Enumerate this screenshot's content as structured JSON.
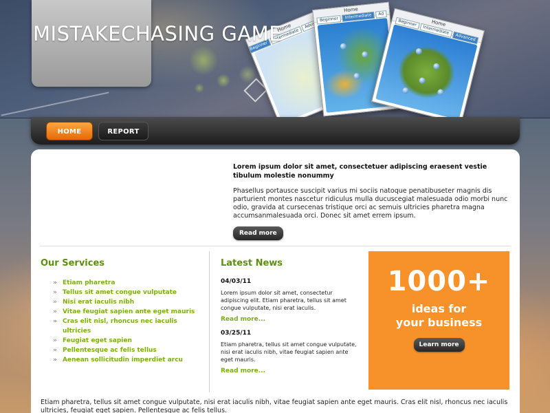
{
  "site": {
    "title": "MISTAKECHASING GAME"
  },
  "promo_cards": [
    {
      "chrome_title": "Home",
      "tabs": [
        "Beginner",
        "Intermediate",
        "Advanced"
      ],
      "active_tab": 0
    },
    {
      "chrome_title": "Home",
      "tabs": [
        "Beginner",
        "Intermediate",
        "Ad"
      ],
      "active_tab": 1
    },
    {
      "chrome_title": "Home",
      "tabs": [
        "Beginner",
        "Intermediate",
        "Advanced"
      ],
      "active_tab": 2
    }
  ],
  "nav": {
    "home": "HOME",
    "report": "REPORT"
  },
  "intro": {
    "heading": "Lorem ipsum dolor sit amet, consectetuer adipiscing eraesent vestie tibulum molestie nonummy",
    "body": "Phasellus portausce suscipit varius mi sociis natoque penatibuseter magnis dis parturient montes nascetur ridiculus mulla ducuscegiat malesuada odio morbi nunc odio, gravida at cursecenas tristique orci ac semuis ultricies pharetra magna accumsanmalesuada orci. Donec sit amet errem ipsum.",
    "button": "Read more"
  },
  "services": {
    "title": "Our Services",
    "items": [
      "Etiam pharetra",
      "Tellus sit amet congue vulputate",
      "Nisi erat iaculis nibh",
      "Vitae feugiat sapien ante eget mauris",
      "Cras elit nisl, rhoncus nec iaculis ultricies",
      "Feugiat eget sapien",
      "Pellentesque ac felis tellus",
      "Aenean sollicitudin imperdiet arcu"
    ]
  },
  "news": {
    "title": "Latest News",
    "items": [
      {
        "date": "04/03/11",
        "text": "Lorem ipsum dolor sit amet, consectetur adipiscing elit. Etiam pharetra, tellus sit amet congue vulputate, nisi erat iaculis.",
        "more": "Read more..."
      },
      {
        "date": "03/25/11",
        "text": "Etiam pharetra, tellus sit amet congue vulputate, nisi erat iaculis nibh, vitae feugiat sapien ante eget mauris.",
        "more": "Read more..."
      }
    ]
  },
  "promo": {
    "big": "1000+",
    "line1": "ideas for",
    "line2": "your business",
    "button": "Learn more"
  },
  "footer": {
    "text": "Etiam pharetra, tellus sit amet congue vulputate, nisi erat iaculis nibh, vitae feugiat sapien ante eget mauris. Cras elit nisl, rhoncus nec iaculis ultricies, feugiat eget sapien. Pellentesque ac felis tellus."
  },
  "colors": {
    "accent_orange": "#f7922b",
    "accent_green": "#7cae13",
    "heading_green": "#5d8f12",
    "nav_dark": "#1d1d1d"
  }
}
